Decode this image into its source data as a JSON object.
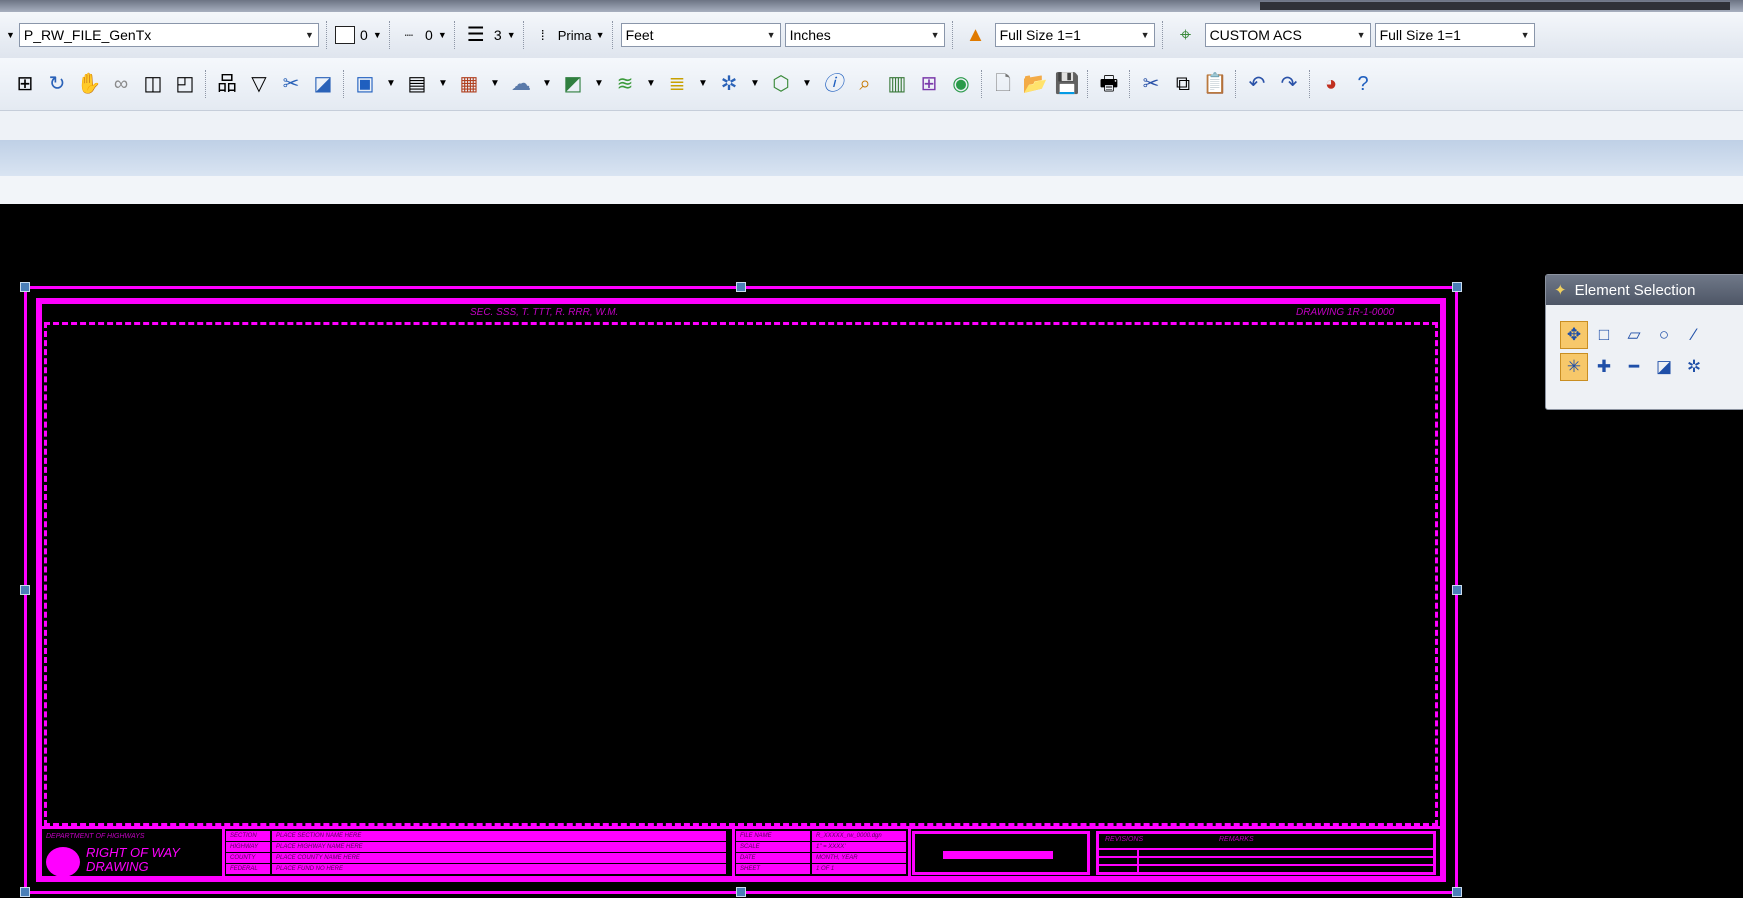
{
  "toolbar_attributes": {
    "level_combo": "P_RW_FILE_GenTx",
    "color_value": "0",
    "line_style_value": "0",
    "line_weight_value": "3",
    "class_label": "Prima",
    "master_units": "Feet",
    "sub_units": "Inches",
    "annotation_scale": "Full Size 1=1",
    "acs": "CUSTOM ACS",
    "drawing_scale": "Full Size 1=1"
  },
  "sheet_border": {
    "top_left_text": "SEC. SSS, T. TTT, R. RRR, W.M.",
    "top_right_text": "DRAWING 1R-1-0000",
    "title_block": {
      "left_title_small": "DEPARTMENT OF HIGHWAYS",
      "left_title_line1": "RIGHT OF WAY",
      "left_title_line2": "DRAWING",
      "rows": [
        {
          "label": "SECTION",
          "value": "PLACE SECTION NAME HERE"
        },
        {
          "label": "HIGHWAY",
          "value": "PLACE HIGHWAY NAME HERE"
        },
        {
          "label": "COUNTY",
          "value": "PLACE COUNTY NAME HERE"
        },
        {
          "label": "FEDERAL",
          "value": "PLACE FUND NO HERE"
        }
      ],
      "right_rows": [
        {
          "label": "FILE NAME",
          "value": "R_XXXXX_rw_0000.dgn"
        },
        {
          "label": "SCALE",
          "value": "1\" = XXXX'"
        },
        {
          "label": "DATE",
          "value": "MONTH, YEAR"
        },
        {
          "label": "SHEET",
          "value": "1 OF 1"
        }
      ],
      "revision_header_left": "REVISIONS",
      "revision_header_right": "REMARKS"
    }
  },
  "element_selection_panel": {
    "title": "Element Selection",
    "tools_row1": [
      "select-point",
      "select-block",
      "select-shape",
      "select-circle",
      "select-line"
    ],
    "tools_row2": [
      "select-mode",
      "mode-add",
      "mode-subtract",
      "mode-invert",
      "mode-all"
    ]
  },
  "colors": {
    "drawing_magenta": "#ff00ff",
    "canvas_background": "#000000",
    "handle_blue": "#4a7fb8"
  }
}
